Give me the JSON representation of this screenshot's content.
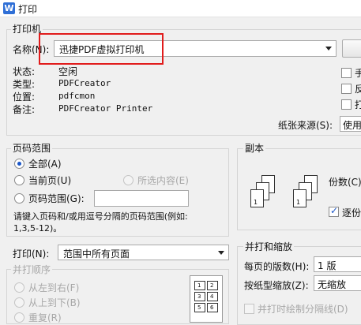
{
  "window": {
    "title": "打印",
    "logo": "W"
  },
  "printer": {
    "group_label": "打印机",
    "name_label": "名称(N):",
    "name_value": "迅捷PDF虚拟打印机",
    "status_label": "状态:",
    "status_value": "空闲",
    "type_label": "类型:",
    "type_value": "PDFCreator",
    "location_label": "位置:",
    "location_value": "pdfcmon",
    "comment_label": "备注:",
    "comment_value": "PDFCreator Printer",
    "check1_label": "手",
    "check2_label": "反",
    "check3_label": "打",
    "paper_source_label": "纸张来源(S):",
    "paper_source_value": "使用"
  },
  "page_range": {
    "group_label": "页码范围",
    "all_label": "全部(A)",
    "current_label": "当前页(U)",
    "selection_label": "所选内容(E)",
    "pages_label": "页码范围(G):",
    "pages_value": "",
    "hint_line1": "请键入页码和/或用逗号分隔的页码范围(例如:",
    "hint_line2": "1,3,5-12)。"
  },
  "copies": {
    "group_label": "副本",
    "count_label": "份数(C)",
    "collate_label": "逐份",
    "page_numbers": [
      "1",
      "2",
      "3",
      "1",
      "2",
      "3"
    ]
  },
  "print_what": {
    "label": "打印(N):",
    "value": "范围中所有页面"
  },
  "print_order": {
    "group_label": "并打顺序",
    "left_right_label": "从左到右(F)",
    "top_bottom_label": "从上到下(B)",
    "repeat_label": "重复(R)",
    "grid_numbers": [
      "1",
      "2",
      "3",
      "4",
      "5",
      "6"
    ]
  },
  "zoom": {
    "group_label": "并打和缩放",
    "pages_per_sheet_label": "每页的版数(H):",
    "pages_per_sheet_value": "1 版",
    "scale_label": "按纸型缩放(Z):",
    "scale_value": "无缩放",
    "draw_border_label": "并打时绘制分隔线(D)"
  },
  "colors": {
    "highlight": "#e11c1c",
    "accent": "#1a56c8"
  }
}
